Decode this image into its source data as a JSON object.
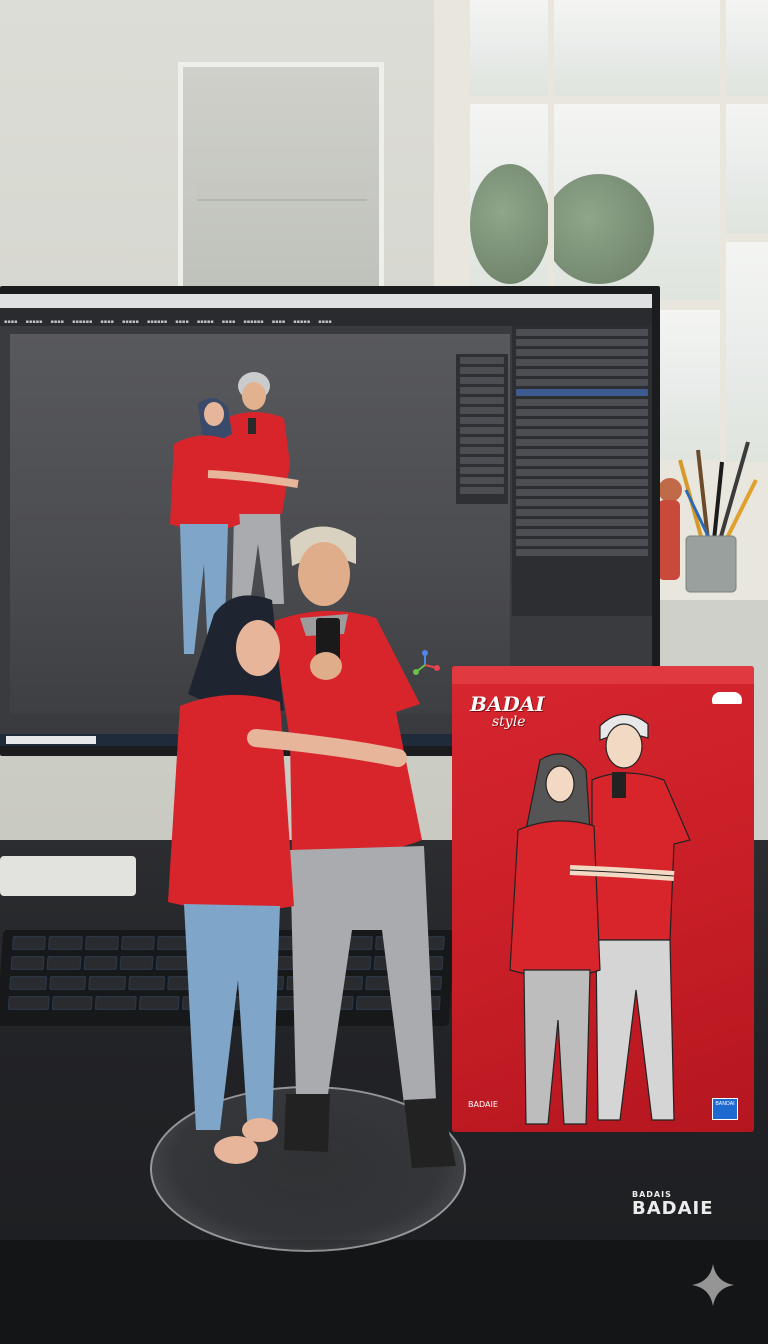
{
  "scene": {
    "description_tags": [
      "photo",
      "figurine",
      "monitor",
      "product-box"
    ]
  },
  "box": {
    "logo_line1": "BADAI",
    "logo_line2": "style",
    "bottom_text_small": "",
    "bottom_text": "BADAIE",
    "corner_logo": "BANDAI"
  },
  "mat": {
    "text_top": "BADAIS",
    "text_main": "BADAIE"
  },
  "colors": {
    "box_red": "#c81e27",
    "shirt_red": "#d8252c",
    "hijab": "#1f2530",
    "jeans": "#7fa6c9",
    "joggers": "#a9abae",
    "screen_bg": "#4b4c50"
  }
}
